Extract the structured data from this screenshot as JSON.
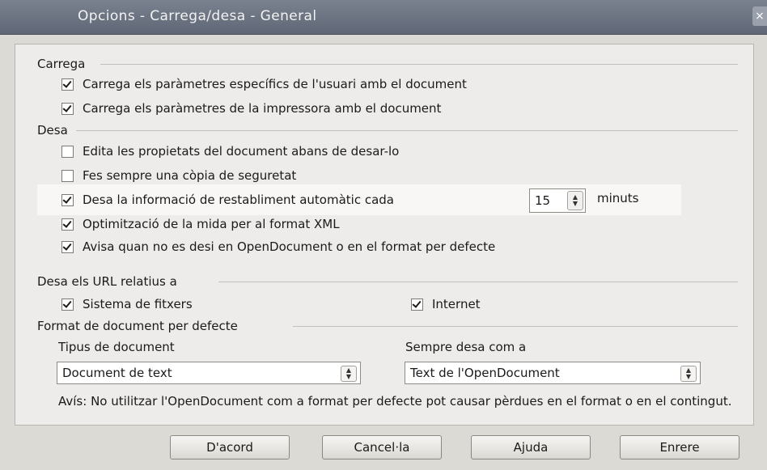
{
  "window": {
    "title": "Opcions - Carrega/desa - General",
    "close_glyph": "×"
  },
  "carrega": {
    "label": "Carrega",
    "items": [
      {
        "text": "Carrega els paràmetres específics de l'usuari amb el document",
        "checked": true
      },
      {
        "text": "Carrega els paràmetres de la impressora amb el document",
        "checked": true
      }
    ]
  },
  "desa": {
    "label": "Desa",
    "items": [
      {
        "text": "Edita les propietats del document abans de desar-lo",
        "checked": false
      },
      {
        "text": "Fes sempre una còpia de seguretat",
        "checked": false
      },
      {
        "text": "Desa la informació de restabliment automàtic cada",
        "checked": true
      },
      {
        "text": "Optimització de la mida per al format XML",
        "checked": true
      },
      {
        "text": "Avisa quan no es desi en OpenDocument o en el format per defecte",
        "checked": true
      }
    ],
    "autosave_value": "15",
    "autosave_unit": "minuts"
  },
  "relative_urls": {
    "label": "Desa els URL relatius a",
    "filesystem": {
      "text": "Sistema de fitxers",
      "checked": true
    },
    "internet": {
      "text": "Internet",
      "checked": true
    }
  },
  "default_format": {
    "label": "Format de document per defecte",
    "doc_type_label": "Tipus de document",
    "doc_type_value": "Document de text",
    "always_save_label": "Sempre desa com a",
    "always_save_value": "Text de l'OpenDocument",
    "warning": "Avís: No utilitzar l'OpenDocument com a format per defecte pot causar pèrdues en el format o en el contingut."
  },
  "buttons": {
    "ok": "D'acord",
    "cancel": "Cancel·la",
    "help": "Ajuda",
    "back": "Enrere"
  }
}
